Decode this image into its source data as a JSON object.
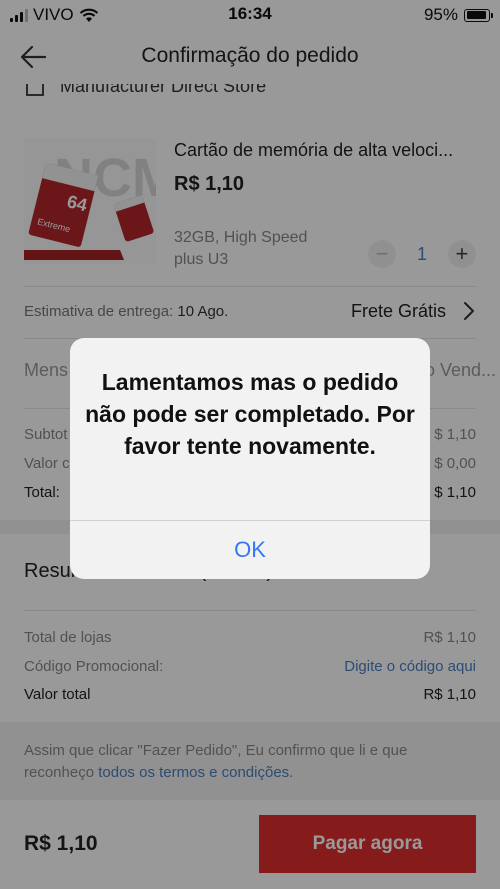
{
  "status_bar": {
    "carrier": "VIVO",
    "time": "16:34",
    "battery": "95%",
    "battery_level": 0.95
  },
  "header": {
    "title": "Confirmação do pedido"
  },
  "store": {
    "name": "Manufacturer Direct Store"
  },
  "product": {
    "name": "Cartão de memória de alta veloci...",
    "price": "R$ 1,10",
    "variant_line1": "32GB, High Speed",
    "variant_line2": "plus U3",
    "quantity": "1",
    "image_text": {
      "brand": "NCM",
      "capacity": "64",
      "label": "Extreme"
    }
  },
  "delivery": {
    "label": "Estimativa de entrega:",
    "date": "10 Ago.",
    "shipping": "Frete Grátis"
  },
  "message": {
    "label_partial": "Mens",
    "seller_partial": "o Vend..."
  },
  "summary": {
    "subtotal_partial": "Subtot",
    "subtotal_value": "$ 1,10",
    "shipping_partial": "Valor c",
    "shipping_value": "$ 0,00",
    "total_label": "Total:",
    "total_value": "$ 1,10"
  },
  "order_summary": {
    "title": "Resumo do Pedido (1 Itens)",
    "rows": [
      {
        "label": "Total de lojas",
        "value": "R$ 1,10"
      },
      {
        "label": "Código Promocional:",
        "value": "Digite o código aqui"
      },
      {
        "label": "Valor total",
        "value": "R$ 1,10"
      }
    ]
  },
  "terms": {
    "text": "Assim que clicar \"Fazer Pedido\", Eu confirmo que li e que reconheço",
    "link": "todos os termos e condições."
  },
  "bottom_bar": {
    "price": "R$ 1,10",
    "pay_label": "Pagar agora"
  },
  "dialog": {
    "message": "Lamentamos mas o pedido não pode ser completado. Por favor tente novamente.",
    "ok_label": "OK"
  },
  "colors": {
    "accent_red": "#e02d2d",
    "link_blue": "#4a7fc0",
    "ios_blue": "#3478f6"
  }
}
